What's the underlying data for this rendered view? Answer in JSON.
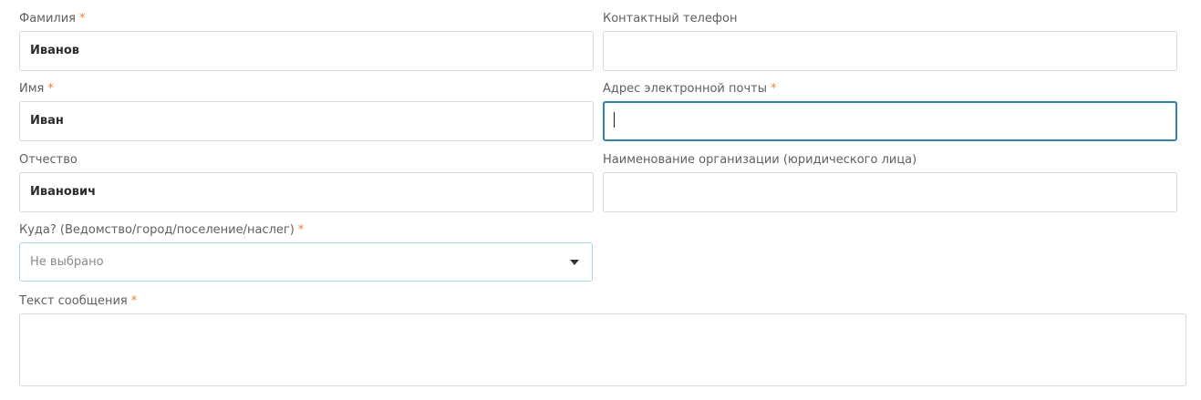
{
  "form": {
    "required_mark": "*",
    "last_name": {
      "label": "Фамилия",
      "value": "Иванов",
      "required": true
    },
    "first_name": {
      "label": "Имя",
      "value": "Иван",
      "required": true
    },
    "middle_name": {
      "label": "Отчество",
      "value": "Иванович",
      "required": false
    },
    "destination": {
      "label": "Куда? (Ведомство/город/поселение/наслег)",
      "selected": "Не выбрано",
      "required": true
    },
    "message": {
      "label": "Текст сообщения",
      "value": "",
      "required": true
    },
    "phone": {
      "label": "Контактный телефон",
      "value": "",
      "required": false
    },
    "email": {
      "label": "Адрес электронной почты",
      "value": "",
      "required": true,
      "focused": true
    },
    "organization": {
      "label": "Наименование организации (юридического лица)",
      "value": "",
      "required": false
    }
  },
  "colors": {
    "required": "#e8833a",
    "focus_border": "#2f84ad",
    "select_border": "#a9d7ea",
    "field_border": "#d9d9d9"
  },
  "icons": {
    "select_arrow": "chevron-down-icon"
  }
}
